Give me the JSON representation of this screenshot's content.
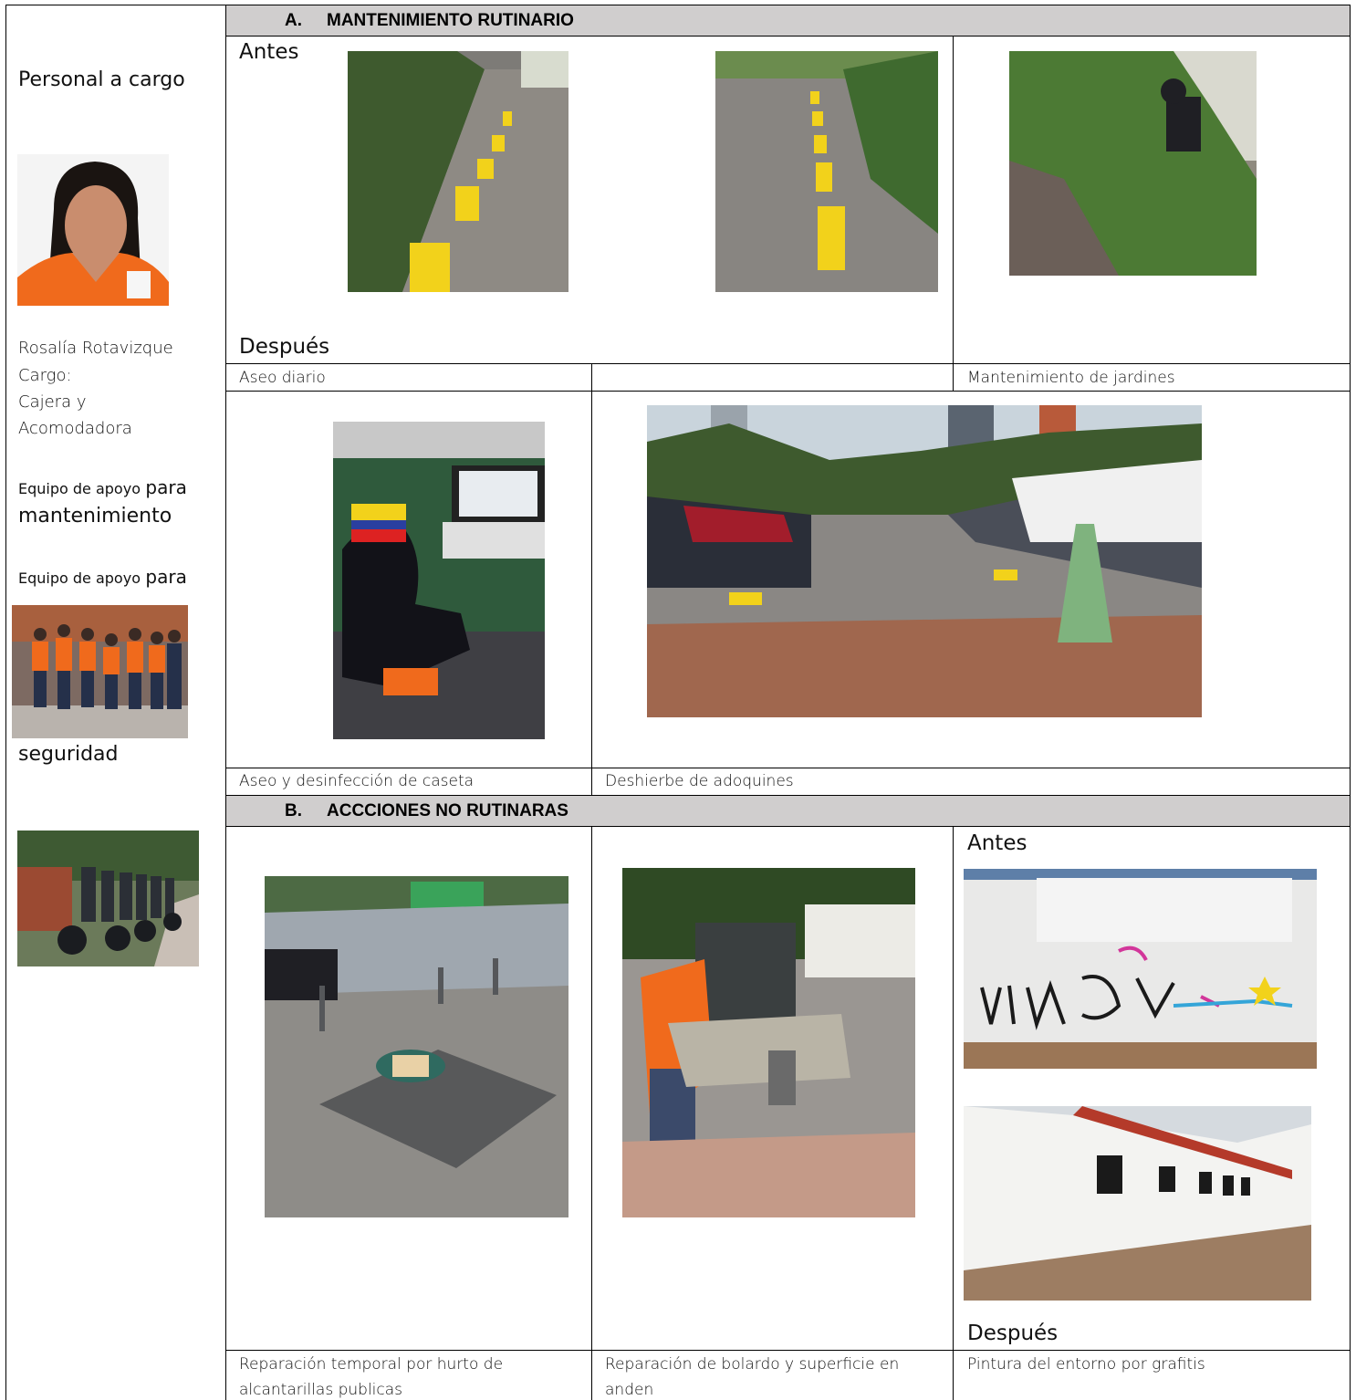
{
  "sidebar": {
    "title": "Personal a cargo",
    "name": "Rosalía Rotavizque",
    "cargo_label": "Cargo:",
    "cargo_line1": "Cajera y",
    "cargo_line2": "Acomodadora",
    "support_small": "Equipo de apoyo",
    "support_para": "para",
    "support_maint": "mantenimiento",
    "support2_small": "Equipo de apoyo",
    "support2_para": "para",
    "support2_security": "seguridad"
  },
  "section_a": {
    "letter": "A.",
    "title": "MANTENIMIENTO RUTINARIO",
    "antes": "Antes",
    "despues": "Después",
    "captions": [
      "Aseo diario",
      "Mantenimiento  de jardines",
      "Aseo y desinfección de caseta",
      "Deshierbe de adoquines"
    ]
  },
  "section_b": {
    "letter": "B.",
    "title": "ACCCIONES NO RUTINARAS",
    "antes": "Antes",
    "despues": "Después",
    "captions": [
      [
        "Reparación temporal por hurto de",
        "alcantarillas publicas"
      ],
      [
        "Reparación de bolardo y superficie en",
        "anden"
      ],
      [
        "Pintura del entorno por grafitis"
      ]
    ]
  },
  "colors": {
    "header_bg": "#d0cece",
    "accent_yellow": "#f2d21b",
    "vest_orange": "#f06a1c"
  }
}
